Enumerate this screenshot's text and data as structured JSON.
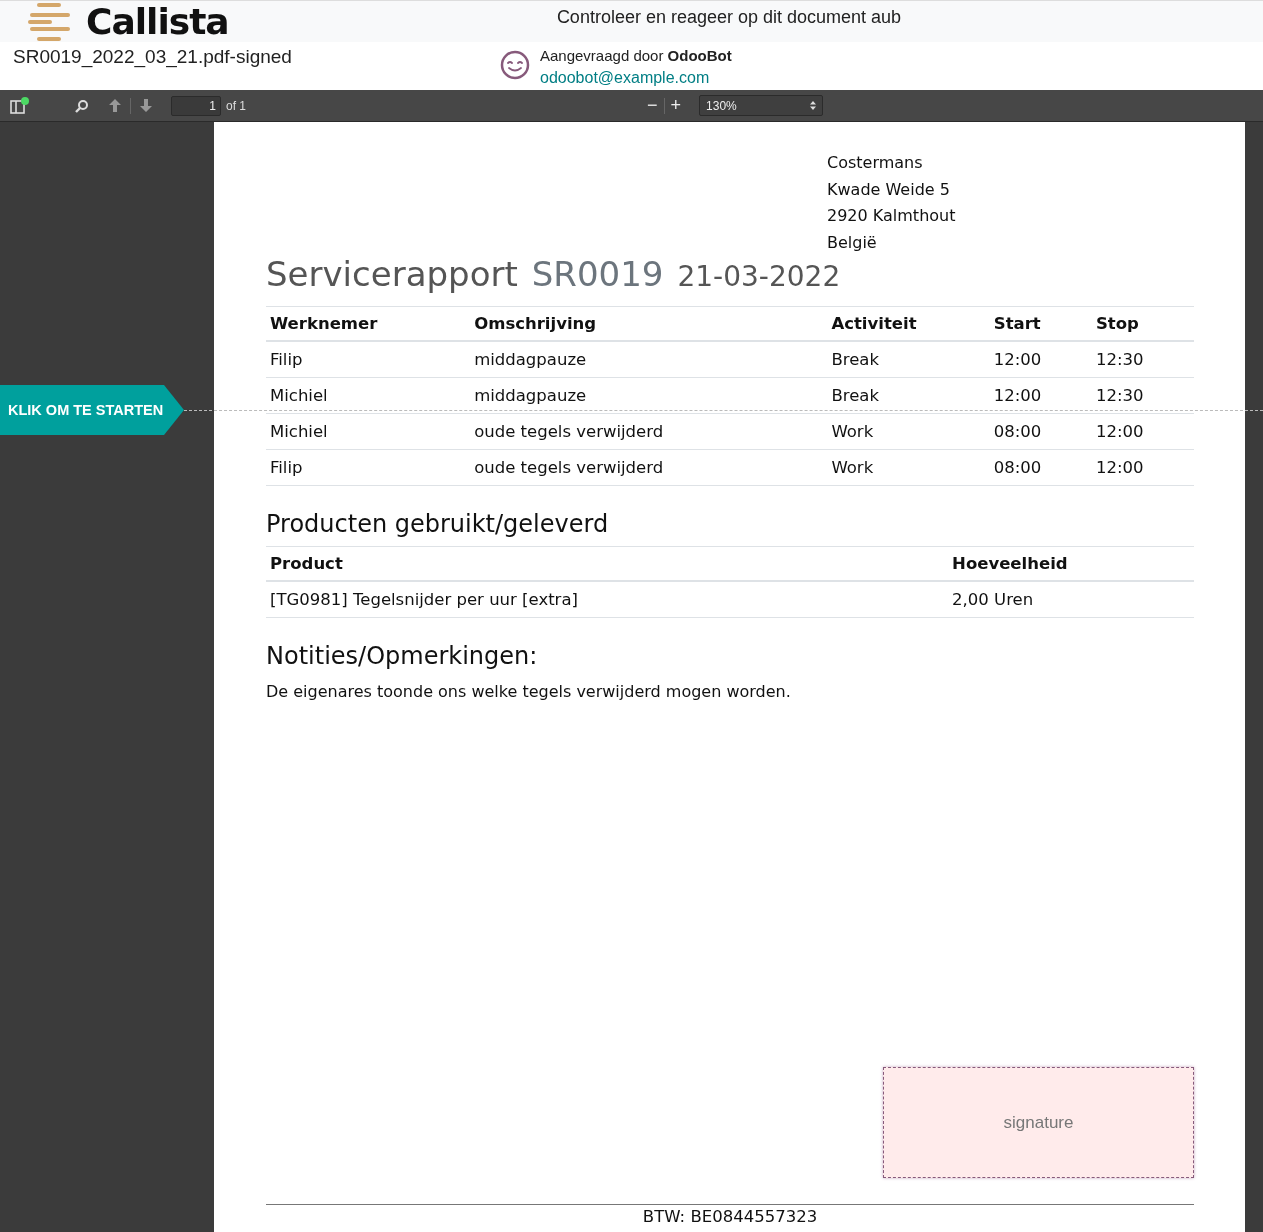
{
  "header": {
    "logo_text": "Callista",
    "title": "Controleer en reageer op dit document aub"
  },
  "document_bar": {
    "filename": "SR0019_2022_03_21.pdf-signed",
    "requested_by": "Aangevraagd door **OdooBot**",
    "email": "odoobot@example.com"
  },
  "toolbar": {
    "page": "1",
    "page_count": "of 1",
    "zoom_out": "−",
    "zoom_in": "+",
    "zoom": "130%"
  },
  "start_button": {
    "label": "KLIK OM TE STARTEN"
  },
  "document": {
    "address": [
      "Costermans",
      "Kwade Weide 5",
      "2920 Kalmthout",
      "België"
    ],
    "title": "Servicerapport",
    "number": "SR0019",
    "date": "21-03-2022",
    "work_table": {
      "columns": [
        "Werknemer",
        "Omschrijving",
        "Activiteit",
        "Start",
        "Stop"
      ],
      "rows": [
        [
          "Filip",
          "middagpauze",
          "Break",
          "12:00",
          "12:30"
        ],
        [
          "Michiel",
          "middagpauze",
          "Break",
          "12:00",
          "12:30"
        ],
        [
          "Michiel",
          "oude tegels verwijderd",
          "Work",
          "08:00",
          "12:00"
        ],
        [
          "Filip",
          "oude tegels verwijderd",
          "Work",
          "08:00",
          "12:00"
        ]
      ]
    },
    "products_heading": "Producten gebruikt/geleverd",
    "products_table": {
      "columns": [
        "Product",
        "Hoeveelheid"
      ],
      "rows": [
        [
          "[TG0981] Tegelsnijder per uur [extra]",
          "2,00 Uren"
        ]
      ]
    },
    "notes_heading": "Notities/Opmerkingen:",
    "notes": "De eigenares toonde ons welke tegels verwijderd mogen worden.",
    "signature": {
      "placeholder": "signature"
    },
    "footer": "BTW: BE0844557323"
  }
}
